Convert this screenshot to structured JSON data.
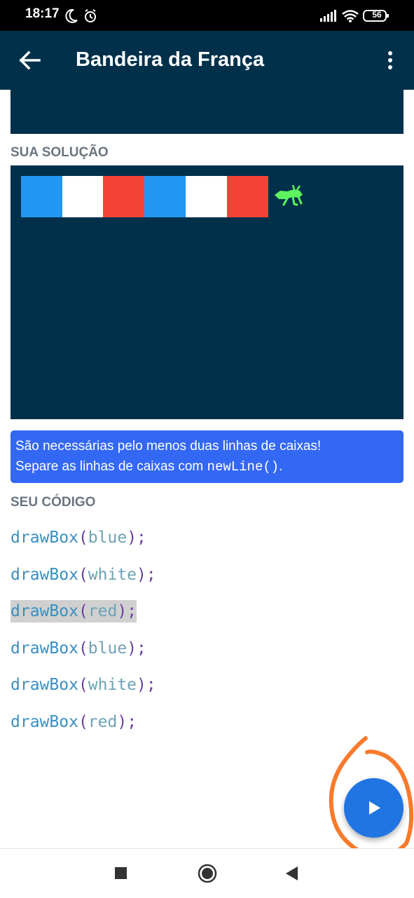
{
  "status_bar": {
    "time": "18:17",
    "battery": "56"
  },
  "app_bar": {
    "title": "Bandeira da França"
  },
  "solution": {
    "label": "SUA SOLUÇÃO",
    "boxes": [
      "blue",
      "white",
      "red",
      "blue",
      "white",
      "red"
    ],
    "box_colors": {
      "blue": "#2196f3",
      "white": "#ffffff",
      "red": "#f44336"
    }
  },
  "hint": {
    "line1": "São necessárias pelo menos duas linhas de caixas!",
    "line2_prefix": "Separe as linhas de caixas com ",
    "line2_code": "newLine()",
    "line2_suffix": "."
  },
  "code": {
    "label": "SEU CÓDIGO",
    "lines": [
      {
        "fn": "drawBox",
        "open": "(",
        "arg": "blue",
        "close": ")",
        "semi": ";"
      },
      {
        "fn": "drawBox",
        "open": "(",
        "arg": "white",
        "close": ")",
        "semi": ";"
      },
      {
        "fn": "drawBox",
        "open": "(",
        "arg": "red",
        "close": ")",
        "semi": ";"
      },
      {
        "fn": "drawBox",
        "open": "(",
        "arg": "blue",
        "close": ")",
        "semi": ";"
      },
      {
        "fn": "drawBox",
        "open": "(",
        "arg": "white",
        "close": ")",
        "semi": ";"
      },
      {
        "fn": "drawBox",
        "open": "(",
        "arg": "red",
        "close": ")",
        "semi": ";"
      }
    ]
  },
  "colors": {
    "app_bar": "#00304a",
    "hint_bg": "#3368f5",
    "fab": "#2175e3",
    "annotation": "#f97a2c",
    "bug": "#5ef25e"
  },
  "icons": {
    "back": "arrow-left-icon",
    "more": "more-vert-icon",
    "run": "play-icon",
    "bug": "grasshopper-icon"
  }
}
